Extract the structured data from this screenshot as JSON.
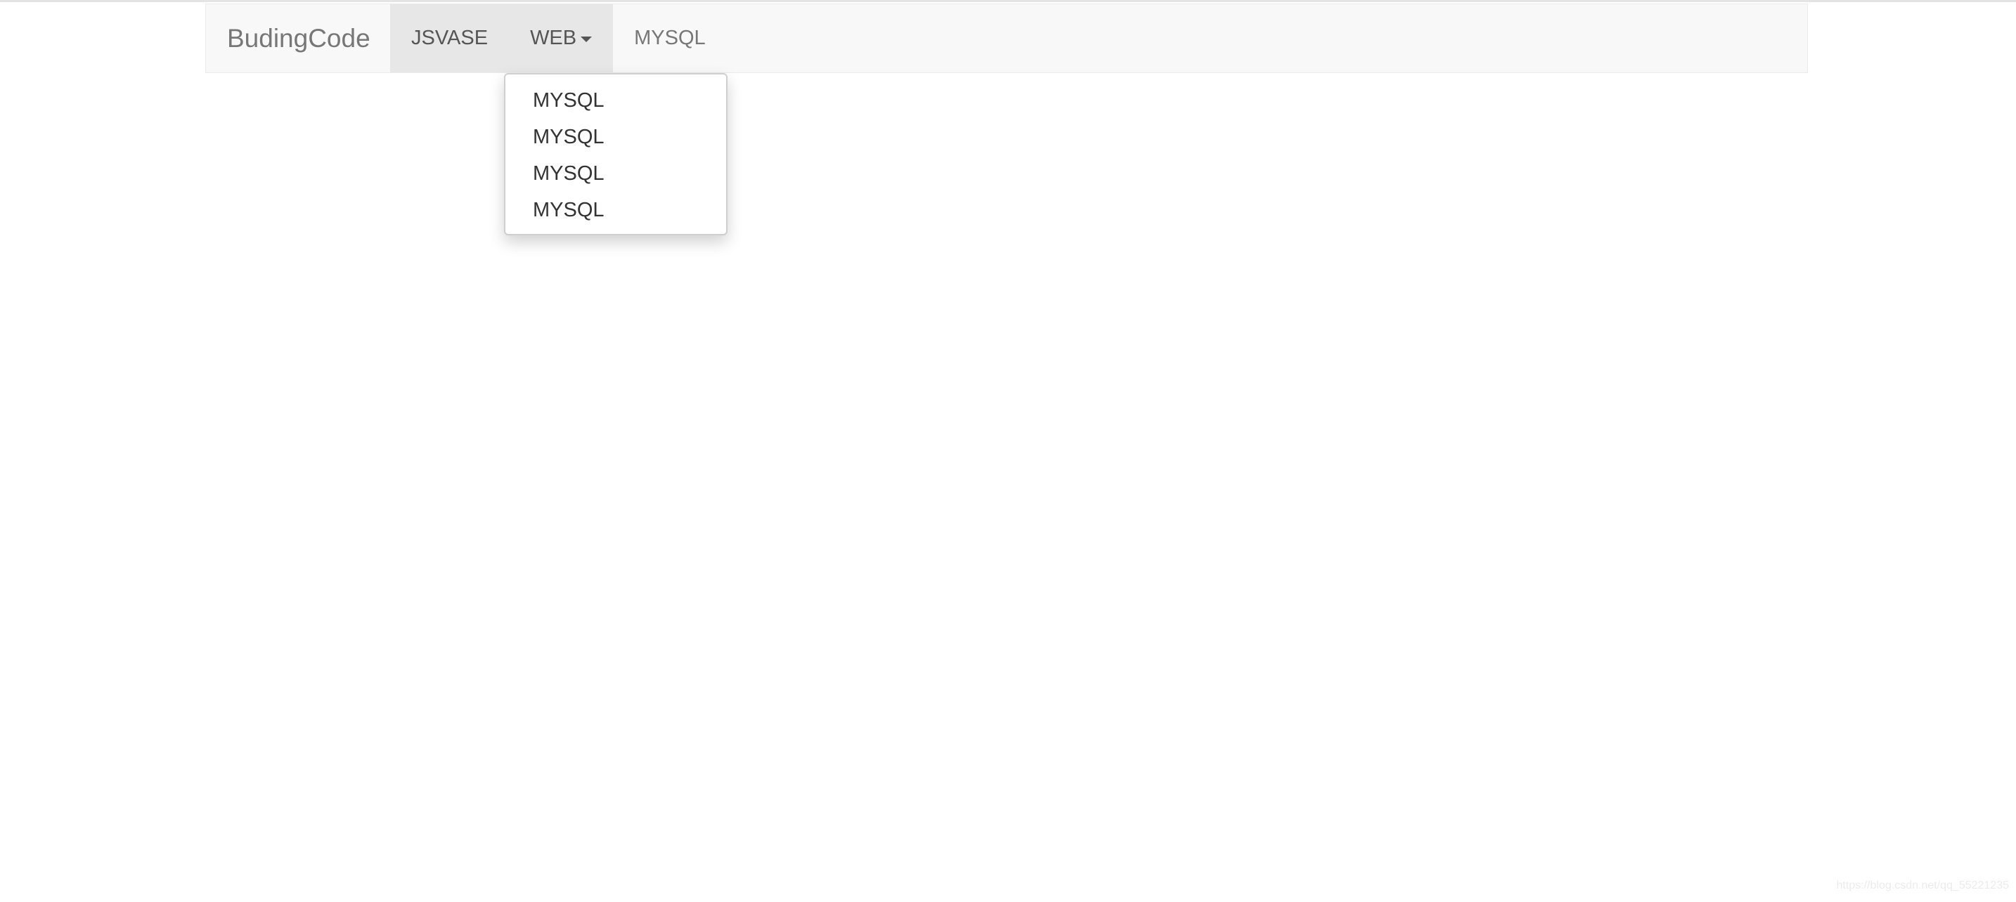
{
  "navbar": {
    "brand": "BudingCode",
    "items": [
      {
        "label": "JSVASE",
        "active": true
      },
      {
        "label": "WEB",
        "active": true,
        "dropdown": true
      },
      {
        "label": "MYSQL",
        "active": false
      }
    ]
  },
  "dropdown": {
    "items": [
      "MYSQL",
      "MYSQL",
      "MYSQL",
      "MYSQL"
    ]
  },
  "watermark": "https://blog.csdn.net/qq_55221235",
  "colors": {
    "navbar_bg": "#f8f8f8",
    "active_bg": "#e7e7e7",
    "text": "#333333",
    "muted_text": "#777777"
  }
}
